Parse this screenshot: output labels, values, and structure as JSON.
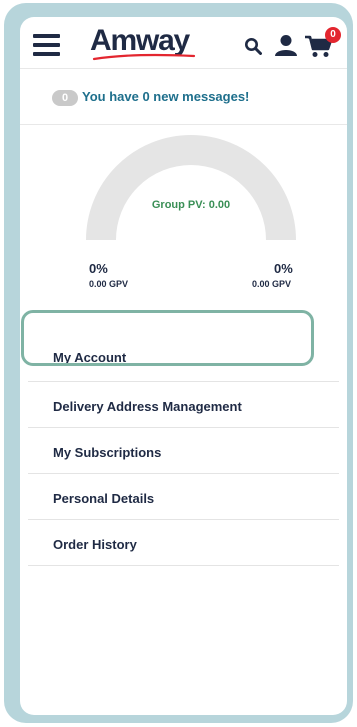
{
  "header": {
    "brand": "Amway",
    "cart_count": "0"
  },
  "messages": {
    "count": "0",
    "text": "You have 0 new messages!"
  },
  "pv_gauge": {
    "label": "Group PV: 0.00",
    "progress": 0,
    "left_percent": "0%",
    "left_gpv": "0.00 GPV",
    "right_percent": "0%",
    "right_gpv": "0.00 GPV"
  },
  "menu": {
    "items": [
      {
        "label": "My Account"
      },
      {
        "label": "Delivery Address Management"
      },
      {
        "label": "My Subscriptions"
      },
      {
        "label": "Personal Details"
      },
      {
        "label": "Order History"
      }
    ]
  },
  "colors": {
    "brand_navy": "#1f2a44",
    "swoosh_red": "#e3262f",
    "message_teal": "#1e6f8c",
    "pv_green": "#3a8f56",
    "highlight": "#7fb3a4",
    "frame": "#b7d5db"
  }
}
